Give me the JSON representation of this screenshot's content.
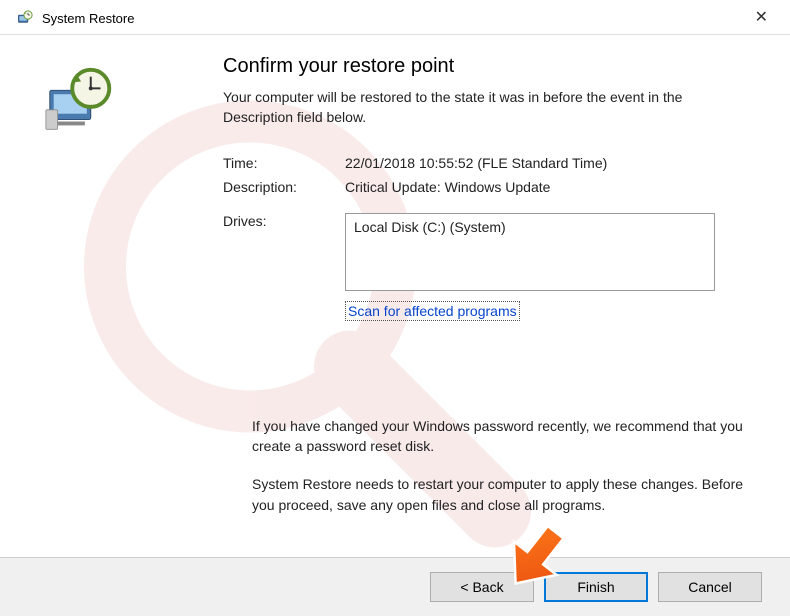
{
  "titlebar": {
    "title": "System Restore"
  },
  "heading": "Confirm your restore point",
  "subtitle": "Your computer will be restored to the state it was in before the event in the Description field below.",
  "info": {
    "time_label": "Time:",
    "time_value": "22/01/2018 10:55:52 (FLE Standard Time)",
    "description_label": "Description:",
    "description_value": "Critical Update: Windows Update",
    "drives_label": "Drives:",
    "drives_value": "Local Disk (C:) (System)"
  },
  "scan_link": "Scan for affected programs",
  "notes": {
    "note1": "If you have changed your Windows password recently, we recommend that you create a password reset disk.",
    "note2": "System Restore needs to restart your computer to apply these changes. Before you proceed, save any open files and close all programs."
  },
  "buttons": {
    "back": "< Back",
    "finish": "Finish",
    "cancel": "Cancel"
  }
}
